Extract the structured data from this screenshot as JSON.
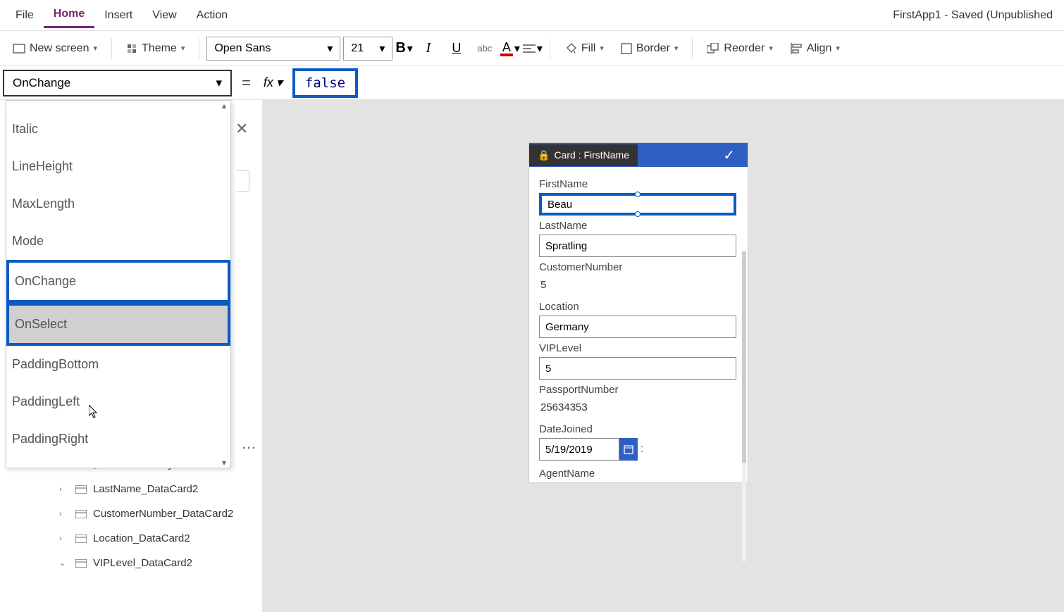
{
  "app_title": "FirstApp1 - Saved (Unpublished",
  "menubar": [
    "File",
    "Home",
    "Insert",
    "View",
    "Action"
  ],
  "menubar_active": "Home",
  "ribbon": {
    "new_screen": "New screen",
    "theme": "Theme",
    "font": "Open Sans",
    "size": "21",
    "fill": "Fill",
    "border": "Border",
    "reorder": "Reorder",
    "align": "Align"
  },
  "property_selector": "OnChange",
  "formula_value": "false",
  "dropdown_items": [
    {
      "label": "Italic",
      "style": ""
    },
    {
      "label": "LineHeight",
      "style": ""
    },
    {
      "label": "MaxLength",
      "style": ""
    },
    {
      "label": "Mode",
      "style": ""
    },
    {
      "label": "OnChange",
      "style": "highlight-blue"
    },
    {
      "label": "OnSelect",
      "style": "highlight-blue-hover"
    },
    {
      "label": "PaddingBottom",
      "style": ""
    },
    {
      "label": "PaddingLeft",
      "style": ""
    },
    {
      "label": "PaddingRight",
      "style": ""
    }
  ],
  "tree": [
    {
      "label": "DataCardKey12",
      "icon": "edit",
      "expand": ""
    },
    {
      "label": "LastName_DataCard2",
      "icon": "card",
      "expand": "›"
    },
    {
      "label": "CustomerNumber_DataCard2",
      "icon": "card",
      "expand": "›"
    },
    {
      "label": "Location_DataCard2",
      "icon": "card",
      "expand": "›"
    },
    {
      "label": "VIPLevel_DataCard2",
      "icon": "card",
      "expand": "⌄"
    }
  ],
  "card": {
    "title": "Card : FirstName",
    "fields": {
      "firstname": {
        "label": "FirstName",
        "value": "Beau"
      },
      "lastname": {
        "label": "LastName",
        "value": "Spratling"
      },
      "customernumber": {
        "label": "CustomerNumber",
        "value": "5"
      },
      "location": {
        "label": "Location",
        "value": "Germany"
      },
      "viplevel": {
        "label": "VIPLevel",
        "value": "5"
      },
      "passportnumber": {
        "label": "PassportNumber",
        "value": "25634353"
      },
      "datejoined": {
        "label": "DateJoined",
        "value": "5/19/2019"
      },
      "agentname": {
        "label": "AgentName"
      }
    }
  }
}
